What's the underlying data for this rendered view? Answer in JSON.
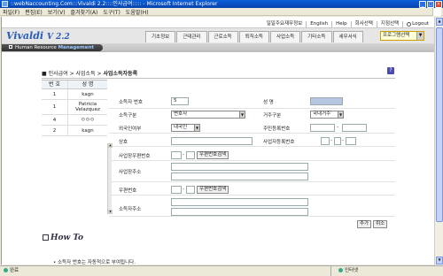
{
  "window": {
    "title": "::webNaccounting.Com:::Vivaldi 2.2::::인사급여::::: - Microsoft Internet Explorer"
  },
  "menu": [
    "파일(F)",
    "편집(E)",
    "보기(V)",
    "즐겨찾기(A)",
    "도구(T)",
    "도움말(H)"
  ],
  "topnav": [
    "일일주요재무정보",
    "English",
    "Help",
    "회사선택",
    "지점선택",
    "Logout"
  ],
  "logo": {
    "name": "Vivaldi",
    "version": "V 2.2"
  },
  "tabs": [
    "기초정보",
    "근태관리",
    "근로소득",
    "퇴직소득",
    "사업소득",
    "기타소득",
    "세무서식"
  ],
  "program_select": "프로그램선택",
  "hrm": {
    "prefix": "Human Resource",
    "emph": "Management"
  },
  "breadcrumb": {
    "a": "인사급여",
    "b": "사업소득",
    "cur": "사업소득자등록"
  },
  "list": {
    "headers": [
      "번 호",
      "성 명"
    ],
    "rows": [
      {
        "no": "1",
        "name": "kagn"
      },
      {
        "no": "1",
        "name": "Patricia Velazquez"
      },
      {
        "no": "4",
        "name": "ㅇㅇㅇ"
      },
      {
        "no": "2",
        "name": "kagn"
      }
    ]
  },
  "form": {
    "income_no_label": "소득자 번호",
    "income_no_value": "5",
    "name_label": "성 명",
    "income_type_label": "소득구분",
    "income_type_value": "변호사",
    "residence_label": "거주구분",
    "residence_value": "국내거주",
    "foreigner_label": "외국인여부",
    "foreigner_value": "내국인",
    "rrn_label": "주민등록번호",
    "rrn_sep": "-",
    "company_label": "상호",
    "bizreg_label": "사업자등록번호",
    "bizreg_sep1": "-",
    "bizreg_sep2": "-",
    "bizzip_label": "사업장우편번호",
    "bizzip_sep": "-",
    "bizzip_btn": "우편번호검색",
    "bizaddr_label": "사업장주소",
    "zip_label": "우편번호",
    "zip_sep": "-",
    "zip_btn": "우편번호검색",
    "addr_label": "소득자주소"
  },
  "buttons": {
    "add": "추가",
    "cancel": "취소"
  },
  "howto": "How To",
  "note": "소득자 번호는 자동적으로 부여됩니다.",
  "status": {
    "left": "완료",
    "right": "인터넷"
  },
  "colors": {
    "titlebar": "#0a5fd8",
    "logo": "#2a5db5",
    "name_box": "#b7c6e0"
  }
}
